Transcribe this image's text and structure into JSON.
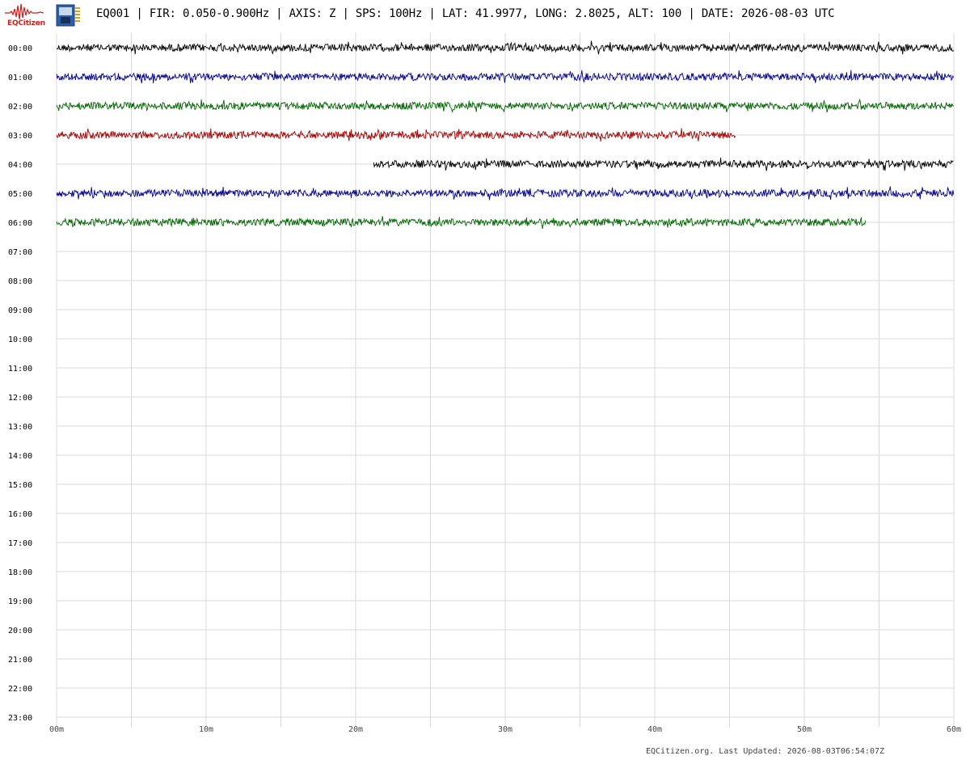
{
  "header": {
    "logo_text": "EQCitizen",
    "title": "EQ001 | FIR: 0.050-0.900Hz | AXIS: Z | SPS: 100Hz | LAT: 41.9977, LONG: 2.8025, ALT: 100 | DATE: 2026-08-03 UTC"
  },
  "footer": {
    "updated": "EQCitizen.org. Last Updated: 2026-08-03T06:54:07Z"
  },
  "colors": {
    "trace_cycle": [
      "#000000",
      "#00008b",
      "#006400",
      "#a50000"
    ],
    "grid": "#d8d8d8",
    "logo": "#cc1f1f"
  },
  "chart_data": {
    "type": "line",
    "subtype": "helicorder",
    "y_rows": [
      "00:00",
      "01:00",
      "02:00",
      "03:00",
      "04:00",
      "05:00",
      "06:00",
      "07:00",
      "08:00",
      "09:00",
      "10:00",
      "11:00",
      "12:00",
      "13:00",
      "14:00",
      "15:00",
      "16:00",
      "17:00",
      "18:00",
      "19:00",
      "20:00",
      "21:00",
      "22:00",
      "23:00"
    ],
    "x_ticks": [
      "00m",
      "10m",
      "20m",
      "30m",
      "40m",
      "50m",
      "60m"
    ],
    "x_range_minutes": [
      0,
      60
    ],
    "minor_gridline_every_minutes": 5,
    "grid": true,
    "series": [
      {
        "row": "00:00",
        "start_min": 0,
        "end_min": 60
      },
      {
        "row": "01:00",
        "start_min": 0,
        "end_min": 60
      },
      {
        "row": "02:00",
        "start_min": 0,
        "end_min": 60
      },
      {
        "row": "03:00",
        "start_min": 0,
        "end_min": 45.4
      },
      {
        "row": "04:00",
        "start_min": 21.2,
        "end_min": 60
      },
      {
        "row": "05:00",
        "start_min": 0,
        "end_min": 60
      },
      {
        "row": "06:00",
        "start_min": 0,
        "end_min": 54.1
      }
    ]
  }
}
